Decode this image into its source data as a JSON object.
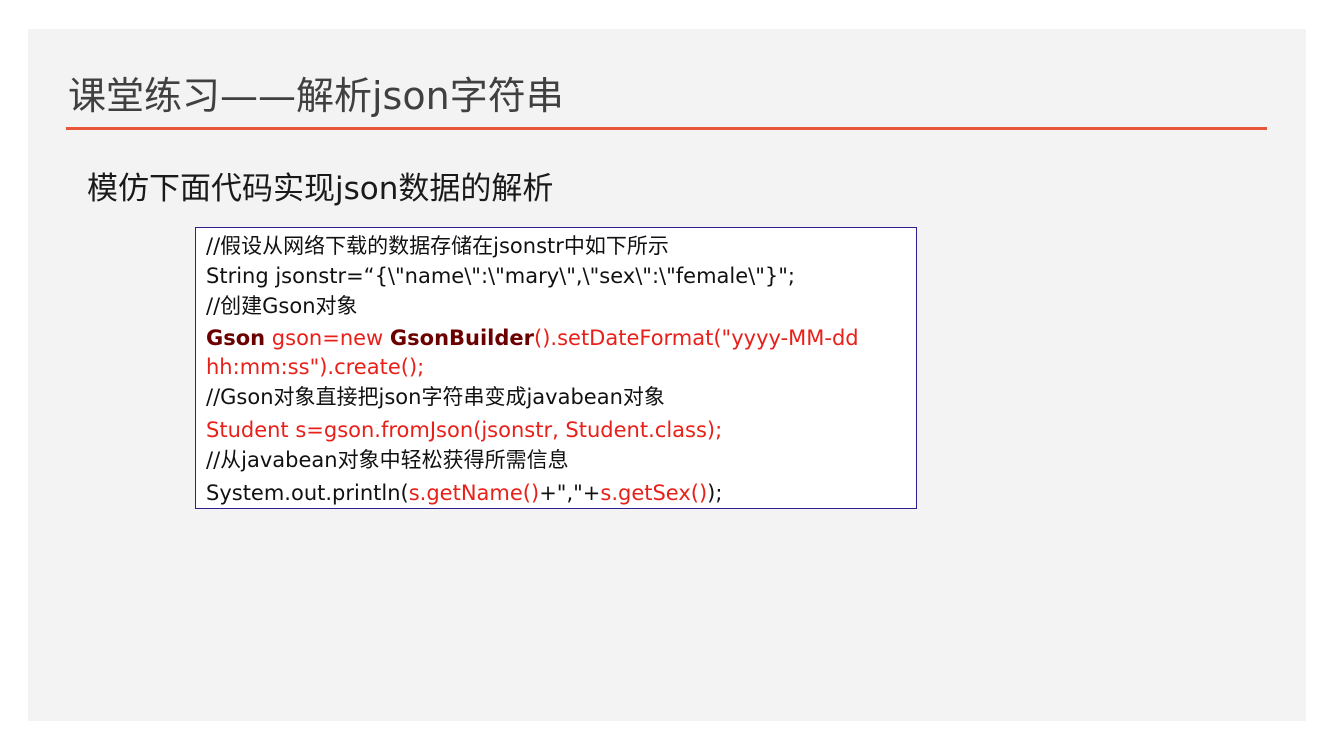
{
  "slide": {
    "title": "课堂练习——解析json字符串",
    "subtitle": "模仿下面代码实现json数据的解析"
  },
  "code": {
    "comment1": "//假设从网络下载的数据存储在jsonstr中如下所示",
    "line1": "String jsonstr=“{\\\"name\\\":\\\"mary\\\",\\\"sex\\\":\\\"female\\\"}\";",
    "comment2": "//创建Gson对象",
    "line2_type": "Gson",
    "line2_mid": " gson=new ",
    "line2_builder": "GsonBuilder",
    "line2_rest": "().setDateFormat(\"yyyy-MM-dd hh:mm:ss\").create();",
    "comment3": "//Gson对象直接把json字符串变成javabean对象",
    "line3": "Student s=gson.fromJson(jsonstr, Student.class);",
    "comment4": "//从javabean对象中轻松获得所需信息",
    "line4_a": "System.out.println(",
    "line4_b": "s.getName()",
    "line4_c": "+\",\"+",
    "line4_d": "s.getSex()",
    "line4_e": ");"
  },
  "colors": {
    "accent_line": "#e8553a",
    "code_red": "#e8201a",
    "code_dark_red": "#6b0000",
    "box_border": "#2e1f8f",
    "slide_bg": "#f3f3f3"
  }
}
